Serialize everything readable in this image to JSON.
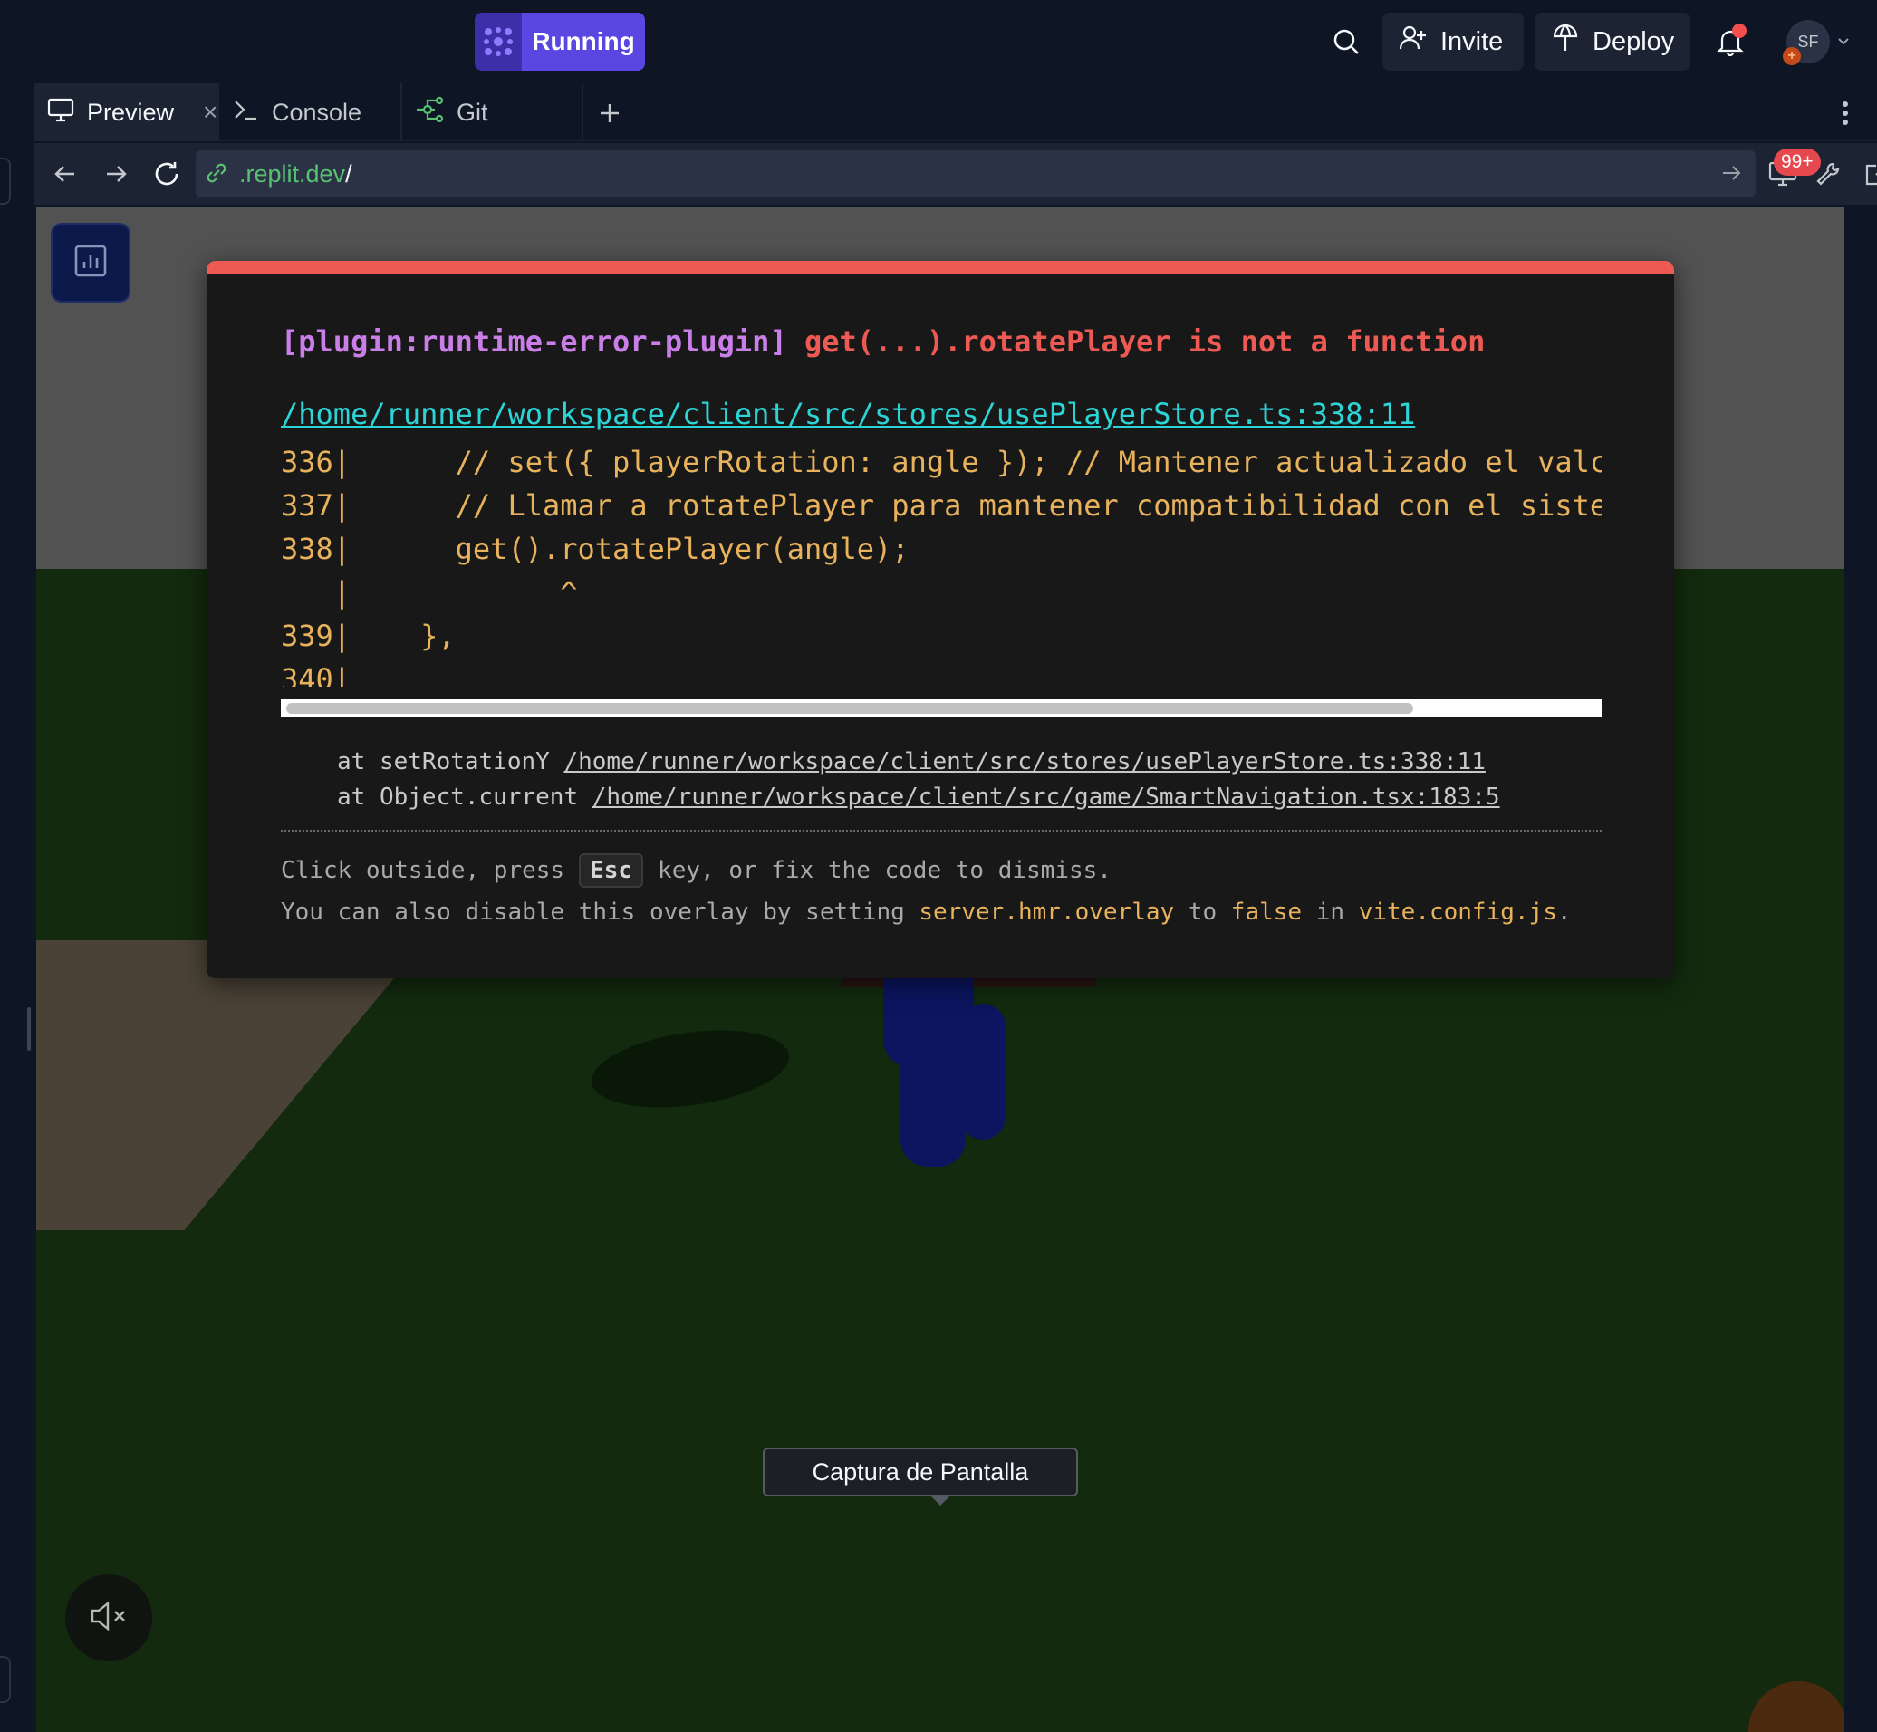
{
  "topbar": {
    "run_label": "Running",
    "invite_label": "Invite",
    "deploy_label": "Deploy",
    "avatar_initials": "SF",
    "avatar_badge": "+"
  },
  "tabs": [
    {
      "label": "Preview",
      "icon": "monitor-icon",
      "active": true
    },
    {
      "label": "Console",
      "icon": "terminal-icon"
    },
    {
      "label": "Git",
      "icon": "git-branch-icon"
    }
  ],
  "tab_close": "×",
  "tab_add": "+",
  "address": {
    "url_domain": ".replit.dev",
    "url_path": "/",
    "devtools_badge": "99+"
  },
  "overlay": {
    "plugin": "[plugin:runtime-error-plugin]",
    "message": "get(...).rotatePlayer is not a function",
    "file": "/home/runner/workspace/client/src/stores/usePlayerStore.ts:338:11",
    "code_lines": [
      "336|      // set({ playerRotation: angle }); // Mantener actualizado el valc",
      "337|      // Llamar a rotatePlayer para mantener compatibilidad con el siste",
      "338|      get().rotatePlayer(angle);",
      "   |            ^",
      "339|    },",
      "340|"
    ],
    "stack": [
      {
        "prefix": "at setRotationY ",
        "link": "/home/runner/workspace/client/src/stores/usePlayerStore.ts:338:11"
      },
      {
        "prefix": "at Object.current ",
        "link": "/home/runner/workspace/client/src/game/SmartNavigation.tsx:183:5"
      }
    ],
    "tip1_before": "Click outside, press",
    "tip1_key": "Esc",
    "tip1_after": "key, or fix the code to dismiss.",
    "tip2_a": "You can also disable this overlay by setting ",
    "tip2_code1": "server.hmr.overlay",
    "tip2_b": " to ",
    "tip2_code2": "false",
    "tip2_c": " in ",
    "tip2_code3": "vite.config.js",
    "tip2_d": "."
  },
  "tooltip": "Captura de Pantalla",
  "colors": {
    "accent": "#5a46e0",
    "error": "#ed5a53",
    "code": "#e8b25c",
    "link": "#2dd4d6",
    "plugin": "#c97ee8"
  }
}
